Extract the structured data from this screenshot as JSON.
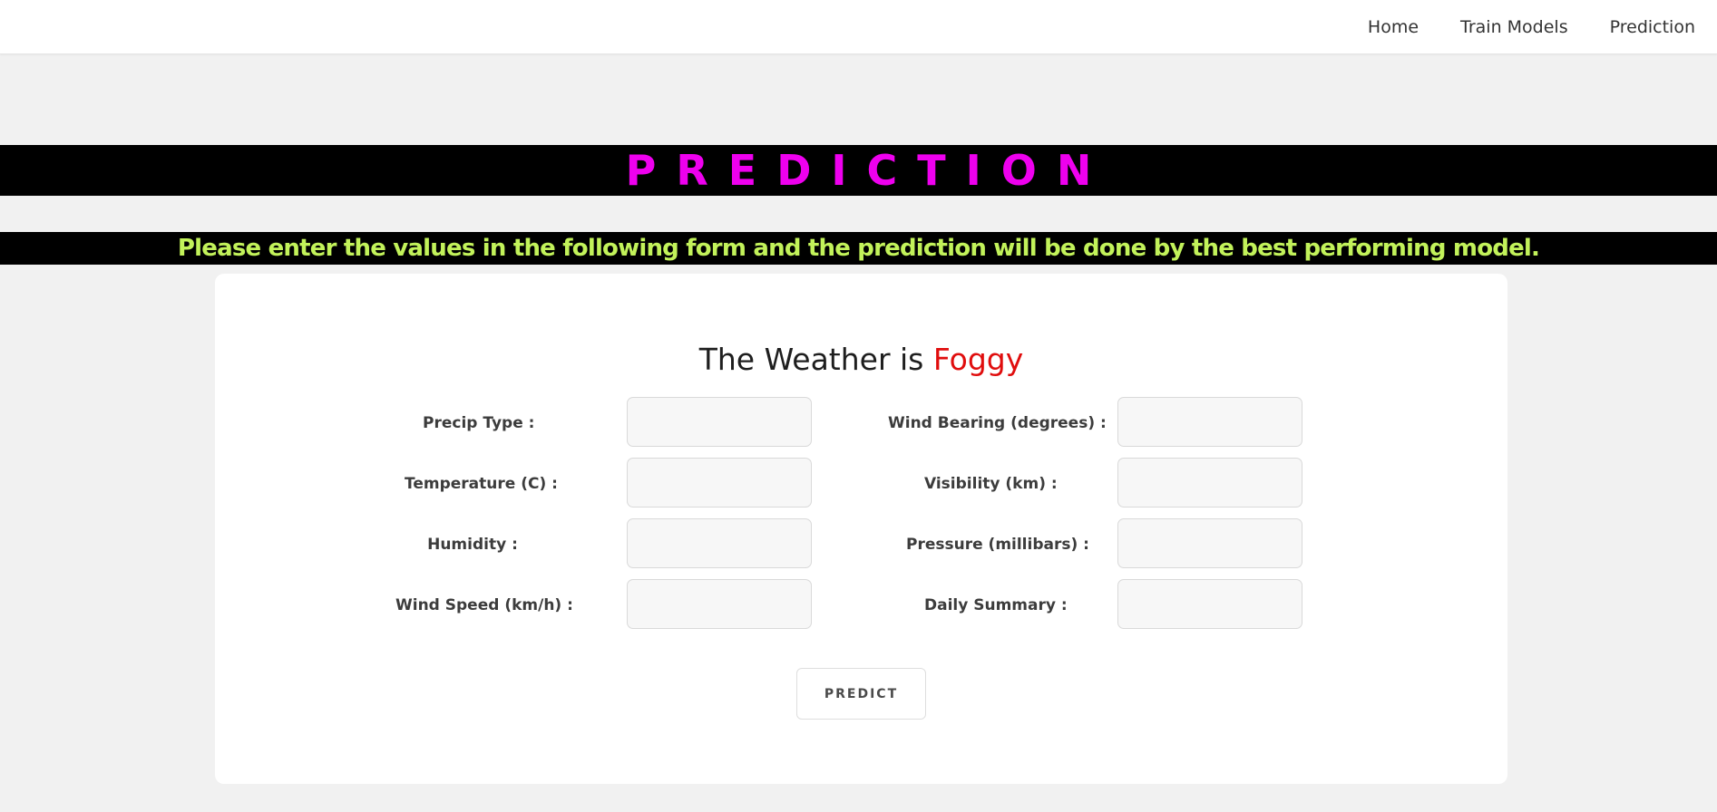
{
  "colors": {
    "magenta": "#ee00ee",
    "lime": "#c2f25a",
    "result_red": "#e00d0d",
    "banner_bg": "#000000",
    "page_bg": "#f1f1f1"
  },
  "nav": {
    "items": [
      {
        "label": "Home"
      },
      {
        "label": "Train Models"
      },
      {
        "label": "Prediction"
      }
    ]
  },
  "banner": {
    "title": "PREDICTION"
  },
  "subtitle": "Please enter the values in the following form and the prediction will be done by the best performing model.",
  "result": {
    "prefix": "The Weather is ",
    "value": "Foggy"
  },
  "form": {
    "left_fields": [
      {
        "label": "Precip Type :",
        "value": ""
      },
      {
        "label": "Temperature (C) :",
        "value": ""
      },
      {
        "label": "Humidity :",
        "value": ""
      },
      {
        "label": "Wind Speed (km/h) :",
        "value": ""
      }
    ],
    "right_fields": [
      {
        "label": "Wind Bearing (degrees) :",
        "value": ""
      },
      {
        "label": "Visibility (km) :",
        "value": ""
      },
      {
        "label": "Pressure (millibars) :",
        "value": ""
      },
      {
        "label": "Daily Summary :",
        "value": ""
      }
    ],
    "submit_label": "PREDICT"
  }
}
